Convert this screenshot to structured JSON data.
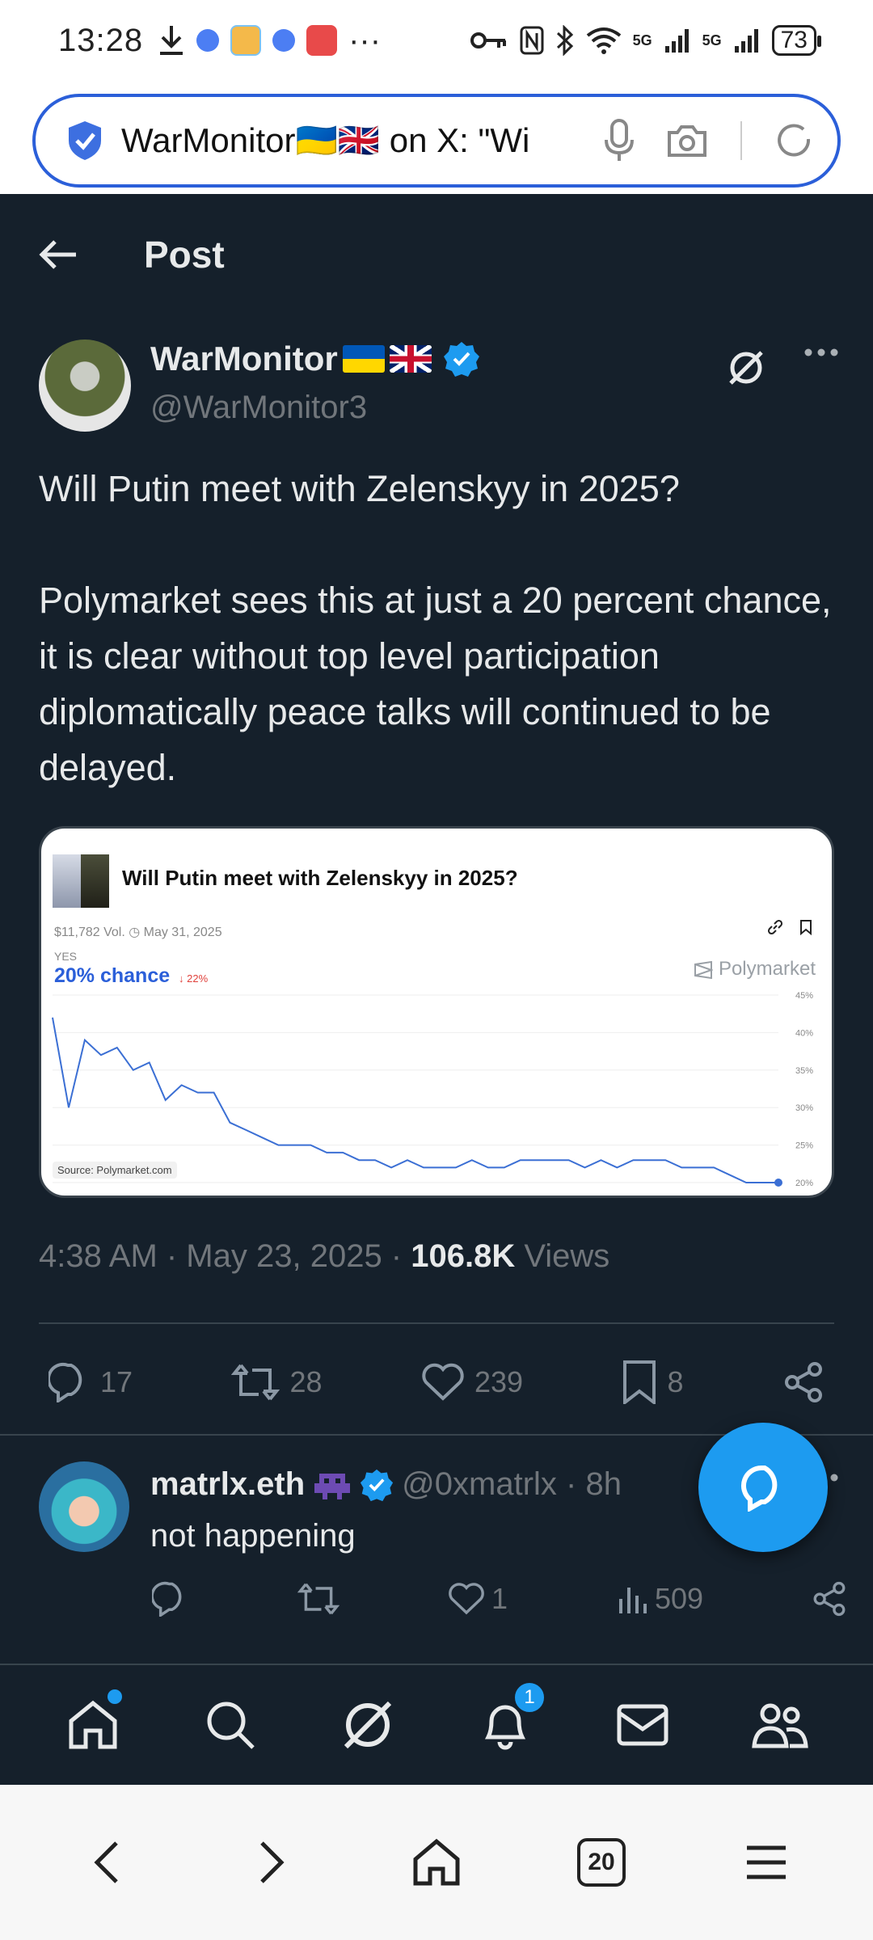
{
  "status_bar": {
    "time": "13:28",
    "battery": "73",
    "network_1": "5G",
    "network_2": "5G",
    "more": "···"
  },
  "url_bar": {
    "text": "WarMonitor🇺🇦🇬🇧 on X: \"Wi"
  },
  "header": {
    "title": "Post"
  },
  "post": {
    "author_name": "WarMonitor",
    "author_handle": "@WarMonitor3",
    "text": "Will Putin meet with Zelenskyy in 2025?\n\nPolymarket sees this at just a 20 percent chance, it is clear without top level participation diplomatically peace talks will continued to be delayed.",
    "time_date": "4:38 AM · May 23, 2025 · ",
    "views_count": "106.8K",
    "views_label": " Views",
    "stats": {
      "replies": "17",
      "reposts": "28",
      "likes": "239",
      "bookmarks": "8"
    }
  },
  "media_card": {
    "title": "Will Putin meet with Zelenskyy in 2025?",
    "meta": "$11,782 Vol.   ◷ May 31, 2025",
    "yes_label": "YES",
    "chance": "20% chance",
    "delta": "↓ 22%",
    "brand": "Polymarket",
    "source": "Source: Polymarket.com",
    "chart_data": {
      "type": "line",
      "ytick_labels": [
        "45%",
        "40%",
        "35%",
        "30%",
        "25%",
        "20%"
      ],
      "ylim": [
        20,
        45
      ],
      "values": [
        42,
        30,
        39,
        37,
        38,
        35,
        36,
        31,
        33,
        32,
        32,
        28,
        27,
        26,
        25,
        25,
        25,
        24,
        24,
        23,
        23,
        22,
        23,
        22,
        22,
        22,
        23,
        22,
        22,
        23,
        23,
        23,
        23,
        22,
        23,
        22,
        23,
        23,
        23,
        22,
        22,
        22,
        21,
        20,
        20,
        20
      ],
      "line_color": "#3b6fd4"
    }
  },
  "reply": {
    "name": "matrlx.eth",
    "handle": "@0xmatrlx · 8h",
    "text": "not happening",
    "likes": "1",
    "views": "509"
  },
  "bottom_nav": {
    "notifications_badge": "1"
  },
  "browser_bar": {
    "tabs_count": "20"
  },
  "colors": {
    "background": "#15202b",
    "accent": "#1d9bf0",
    "muted": "#71767b"
  }
}
